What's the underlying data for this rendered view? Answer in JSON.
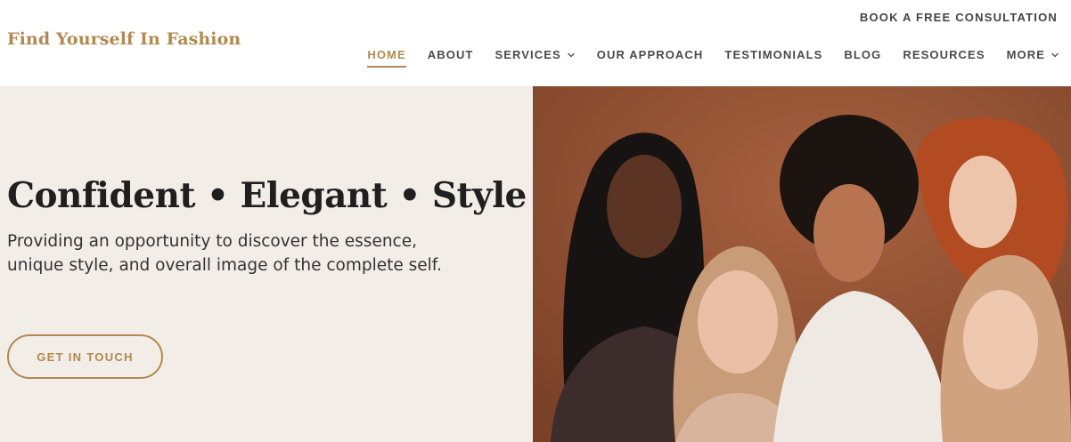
{
  "brand": {
    "name": "Find Yourself In Fashion"
  },
  "header": {
    "cta": "BOOK A FREE CONSULTATION"
  },
  "nav": {
    "items": [
      {
        "label": "HOME",
        "active": true
      },
      {
        "label": "ABOUT"
      },
      {
        "label": "SERVICES",
        "dropdown": true
      },
      {
        "label": "OUR APPROACH"
      },
      {
        "label": "TESTIMONIALS"
      },
      {
        "label": "BLOG"
      },
      {
        "label": "RESOURCES"
      },
      {
        "label": "MORE",
        "dropdown": true
      }
    ]
  },
  "hero": {
    "headline": "Confident • Elegant • Style",
    "subtext": "Providing an opportunity to discover the essence, unique style, and overall image of the complete self.",
    "button": "GET IN TOUCH",
    "image_icon": "group-portrait-photo"
  },
  "colors": {
    "accent": "#b08a50",
    "hero_bg": "#f3ede8",
    "photo_bg": "#8e5034",
    "text_dark": "#1f1f1f"
  }
}
